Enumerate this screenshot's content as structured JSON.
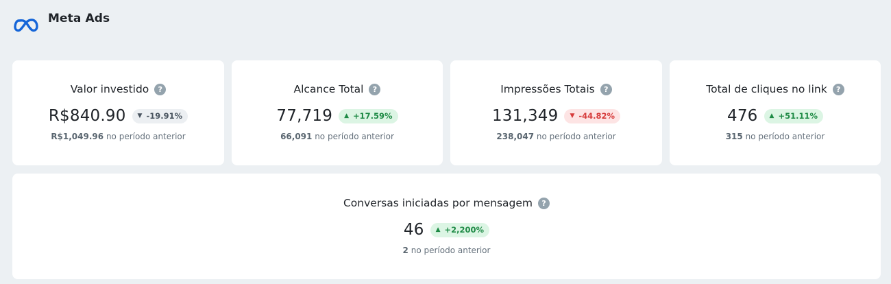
{
  "header": {
    "title": "Meta Ads",
    "logo_icon": "meta-infinity-logo",
    "logo_color": "#1565d8"
  },
  "cards": [
    {
      "title": "Valor investido",
      "value": "R$840.90",
      "change": "-19.91%",
      "trend": "neutral",
      "prev_value": "R$1,049.96",
      "prev_text": "no período anterior"
    },
    {
      "title": "Alcance Total",
      "value": "77,719",
      "change": "+17.59%",
      "trend": "up",
      "prev_value": "66,091",
      "prev_text": "no período anterior"
    },
    {
      "title": "Impressões Totais",
      "value": "131,349",
      "change": "-44.82%",
      "trend": "down",
      "prev_value": "238,047",
      "prev_text": "no período anterior"
    },
    {
      "title": "Total de cliques no link",
      "value": "476",
      "change": "+51.11%",
      "trend": "up",
      "prev_value": "315",
      "prev_text": "no período anterior"
    },
    {
      "title": "Conversas iniciadas por mensagem",
      "value": "46",
      "change": "+2,200%",
      "trend": "up",
      "prev_value": "2",
      "prev_text": "no período anterior"
    }
  ],
  "icons": {
    "help": "question-mark-circle-icon",
    "help_glyph": "?",
    "up": "triangle-up-icon",
    "up_glyph": "▲",
    "down": "triangle-down-icon",
    "down_glyph": "▼"
  },
  "colors": {
    "background": "#ecf0f3",
    "card": "#ffffff",
    "positive": "#1e8a45",
    "positive_bg": "#dcf5e4",
    "negative": "#d63b3b",
    "negative_bg": "#fde4e4",
    "neutral": "#4a5560",
    "neutral_bg": "#eceff2"
  }
}
